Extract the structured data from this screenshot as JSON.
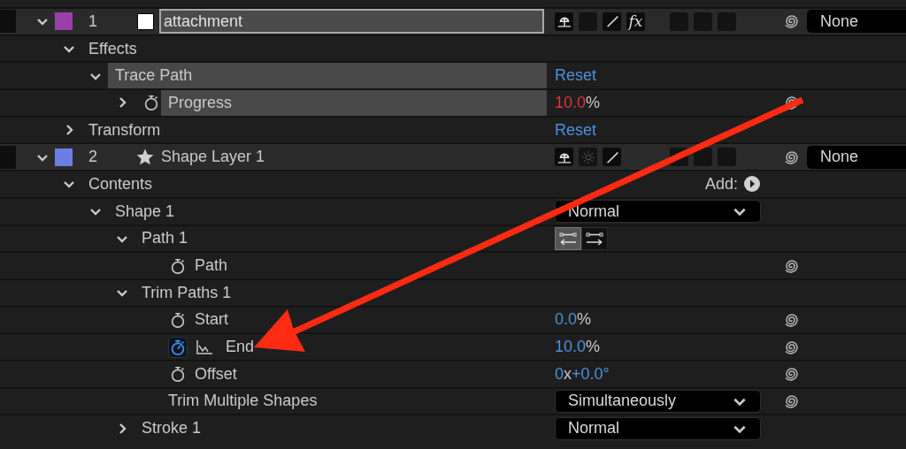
{
  "layers": [
    {
      "number": "1",
      "color": "#9b3fa8",
      "source": {
        "kind": "solid"
      },
      "name": "attachment",
      "renaming": true,
      "expanded": true,
      "switches": [
        {
          "kind": "shy",
          "on": true
        },
        {
          "kind": "blank",
          "on": false
        },
        {
          "kind": "quality",
          "on": true
        },
        {
          "kind": "fx",
          "label": "fx",
          "on": true
        }
      ],
      "toggles": [
        {
          "kind": "blank",
          "on": false
        },
        {
          "kind": "blank",
          "on": false
        },
        {
          "kind": "blank",
          "on": false
        }
      ],
      "parent": "None",
      "children": [
        {
          "name": "Effects",
          "expanded": true,
          "children": [
            {
              "name": "Trace Path",
              "expanded": true,
              "highlighted": true,
              "action": "Reset",
              "children": [
                {
                  "name": "Progress",
                  "expanded": false,
                  "stopwatch": {
                    "active": false
                  },
                  "highlighted": true,
                  "value_parts": [
                    {
                      "text": "10.0",
                      "kind": "expression"
                    },
                    {
                      "text": "%",
                      "kind": "unit"
                    }
                  ],
                  "pickwhip": true
                }
              ]
            }
          ]
        },
        {
          "name": "Transform",
          "expanded": false,
          "action": "Reset"
        }
      ]
    },
    {
      "number": "2",
      "color": "#6b7fe3",
      "source": {
        "kind": "shape"
      },
      "name": "Shape Layer 1",
      "renaming": false,
      "expanded": true,
      "switches": [
        {
          "kind": "shy",
          "on": true
        },
        {
          "kind": "collapse",
          "on": false
        },
        {
          "kind": "quality",
          "on": true
        },
        {
          "kind": "none"
        }
      ],
      "toggles": [
        {
          "kind": "blank",
          "on": false
        },
        {
          "kind": "blank",
          "on": false
        },
        {
          "kind": "blank",
          "on": false
        }
      ],
      "parent": "None",
      "children": [
        {
          "name": "Contents",
          "expanded": true,
          "add_label": "Add:",
          "children": [
            {
              "name": "Shape 1",
              "expanded": true,
              "dropdown": "Normal",
              "children": [
                {
                  "name": "Path 1",
                  "expanded": true,
                  "direction_buttons": [
                    {
                      "kind": "reverse",
                      "selected": true
                    },
                    {
                      "kind": "forward",
                      "selected": false
                    }
                  ],
                  "children": [
                    {
                      "name": "Path",
                      "stopwatch": {
                        "active": false
                      },
                      "pickwhip": true
                    }
                  ]
                },
                {
                  "name": "Trim Paths 1",
                  "expanded": true,
                  "children": [
                    {
                      "name": "Start",
                      "stopwatch": {
                        "active": false
                      },
                      "value_parts": [
                        {
                          "text": "0.0",
                          "kind": "number"
                        },
                        {
                          "text": "%",
                          "kind": "unit"
                        }
                      ],
                      "pickwhip": true
                    },
                    {
                      "name": "End",
                      "stopwatch": {
                        "active": true
                      },
                      "graph": true,
                      "value_parts": [
                        {
                          "text": "10.0",
                          "kind": "number"
                        },
                        {
                          "text": "%",
                          "kind": "unit"
                        }
                      ],
                      "pickwhip": true
                    },
                    {
                      "name": "Offset",
                      "stopwatch": {
                        "active": false
                      },
                      "value_parts": [
                        {
                          "text": "0",
                          "kind": "number"
                        },
                        {
                          "text": "x",
                          "kind": "unit"
                        },
                        {
                          "text": "+0.0°",
                          "kind": "number"
                        }
                      ],
                      "pickwhip": true
                    },
                    {
                      "name": "Trim Multiple Shapes",
                      "dropdown": "Simultaneously",
                      "pickwhip": true
                    }
                  ]
                },
                {
                  "name": "Stroke 1",
                  "expanded": false,
                  "dropdown": "Normal"
                }
              ]
            }
          ]
        }
      ]
    }
  ]
}
